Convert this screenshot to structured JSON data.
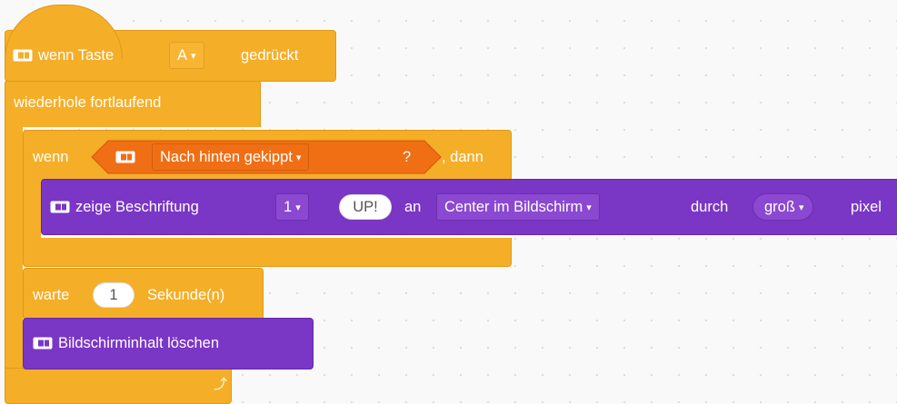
{
  "hat": {
    "label_prefix": "wenn Taste",
    "key_value": "A",
    "label_suffix": "gedrückt"
  },
  "forever": {
    "label": "wiederhole fortlaufend"
  },
  "if_block": {
    "label_if": "wenn",
    "condition": "Nach hinten gekippt",
    "question_mark": "?",
    "label_then": ", dann"
  },
  "show_label": {
    "prefix": "zeige Beschriftung",
    "index": "1",
    "text": "UP!",
    "label_at": "an",
    "position": "Center im Bildschirm",
    "label_by": "durch",
    "size": "groß",
    "suffix": "pixel"
  },
  "wait": {
    "prefix": "warte",
    "seconds": "1",
    "suffix": "Sekunde(n)"
  },
  "clear": {
    "label": "Bildschirminhalt löschen"
  },
  "dropdown_arrow": "▾",
  "loop_arrow": "⤴",
  "colors": {
    "control": "#f5ae27",
    "display": "#7a36c5",
    "sensing": "#f06f15"
  }
}
